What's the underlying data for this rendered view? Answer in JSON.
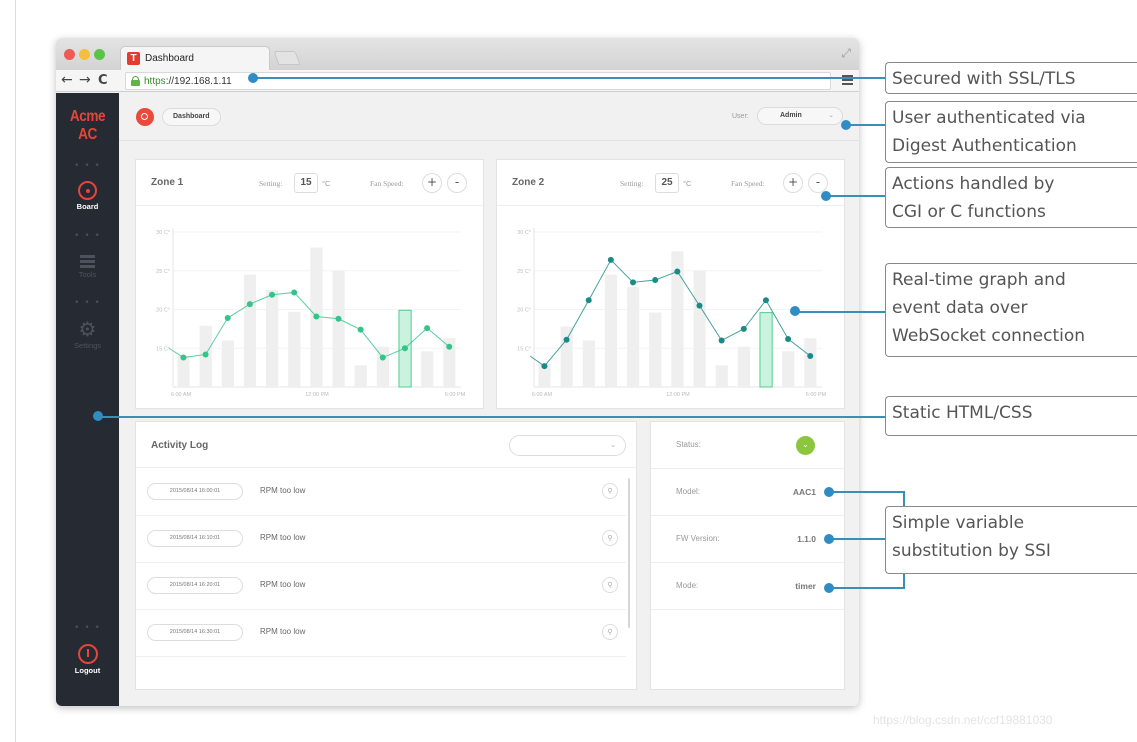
{
  "browser": {
    "tab_title": "Dashboard",
    "favicon_letter": "T",
    "url_scheme": "https",
    "url_rest": "://192.168.1.11"
  },
  "sidebar": {
    "brand": "Acme AC",
    "items": [
      {
        "label": "Board",
        "icon": "gauge-icon",
        "active": true
      },
      {
        "label": "Tools",
        "icon": "tools-icon",
        "active": false
      },
      {
        "label": "Settings",
        "icon": "gear-icon",
        "active": false
      }
    ],
    "logout_label": "Logout",
    "dots": "• • •"
  },
  "topbar": {
    "breadcrumb": "Dashboard",
    "user_label": "User:",
    "user_value": "Admin"
  },
  "zones": [
    {
      "title": "Zone 1",
      "setting_label": "Setting:",
      "setting_value": "15",
      "unit": "°C",
      "fan_label": "Fan Speed:",
      "plus": "+",
      "minus": "-"
    },
    {
      "title": "Zone 2",
      "setting_label": "Setting:",
      "setting_value": "25",
      "unit": "°C",
      "fan_label": "Fan Speed:",
      "plus": "+",
      "minus": "-"
    }
  ],
  "chart_data": [
    {
      "type": "line",
      "title": "Zone 1",
      "y_ticks": [
        "15 C°",
        "20 C°",
        "25 C°",
        "30 C°"
      ],
      "x_ticks": [
        "6:00 AM",
        "12:00 PM",
        "6:00 PM"
      ],
      "ylim": [
        10,
        30
      ],
      "line_color": "#33c48a",
      "highlight_index": 10,
      "line_start": 15,
      "line_values": [
        13.8,
        14.2,
        18.9,
        20.7,
        21.9,
        22.2,
        19.1,
        18.8,
        17.4,
        13.8,
        15.0,
        17.6,
        15.2
      ],
      "bar_values": [
        14,
        17.9,
        16,
        24.5,
        22.5,
        19.7,
        28,
        25,
        12.8,
        15.2,
        19.9,
        14.6,
        16.3
      ]
    },
    {
      "type": "line",
      "title": "Zone 2",
      "y_ticks": [
        "15 C°",
        "20 C°",
        "25 C°",
        "30 C°"
      ],
      "x_ticks": [
        "6:00 AM",
        "12:00 PM",
        "6:00 PM"
      ],
      "ylim": [
        10,
        30
      ],
      "line_color": "#1a8a86",
      "highlight_index": 10,
      "line_start": 14,
      "line_values": [
        12.7,
        16.1,
        21.2,
        26.4,
        23.5,
        23.8,
        24.9,
        20.5,
        16.0,
        17.5,
        21.2,
        16.2,
        14.0
      ],
      "bar_values": [
        13,
        17.8,
        16,
        24.5,
        22.9,
        19.6,
        27.5,
        25,
        12.8,
        15.2,
        19.6,
        14.6,
        16.3
      ]
    }
  ],
  "activity_log": {
    "title": "Activity Log",
    "filter_value": "",
    "rows": [
      {
        "timestamp": "2015/08/14 16:00:01",
        "message": "RPM too low"
      },
      {
        "timestamp": "2015/08/14 16:10:01",
        "message": "RPM too low"
      },
      {
        "timestamp": "2015/08/14 16:20:01",
        "message": "RPM too low"
      },
      {
        "timestamp": "2015/08/14 16:30:01",
        "message": "RPM too low"
      }
    ]
  },
  "status_panel": {
    "rows": [
      {
        "label": "Status:",
        "value": "",
        "ok": true
      },
      {
        "label": "Model:",
        "value": "AAC1"
      },
      {
        "label": "FW Version:",
        "value": "1.1.0"
      },
      {
        "label": "Mode:",
        "value": "timer"
      }
    ],
    "ok_color": "#8cc63e"
  },
  "callouts": [
    {
      "lines": [
        "Secured with SSL/TLS"
      ]
    },
    {
      "lines": [
        "User authenticated via",
        "Digest Authentication"
      ]
    },
    {
      "lines": [
        "Actions handled by",
        "CGI or C functions"
      ]
    },
    {
      "lines": [
        "Real-time graph and",
        "event data over",
        "WebSocket connection"
      ]
    },
    {
      "lines": [
        "Static HTML/CSS"
      ]
    },
    {
      "lines": [
        "Simple variable",
        "substitution by SSI"
      ]
    }
  ],
  "watermark": "https://blog.csdn.net/ccf19881030",
  "colors": {
    "accent": "#e4473a",
    "connector": "#3a8fb7",
    "sidebar": "#262a32"
  }
}
